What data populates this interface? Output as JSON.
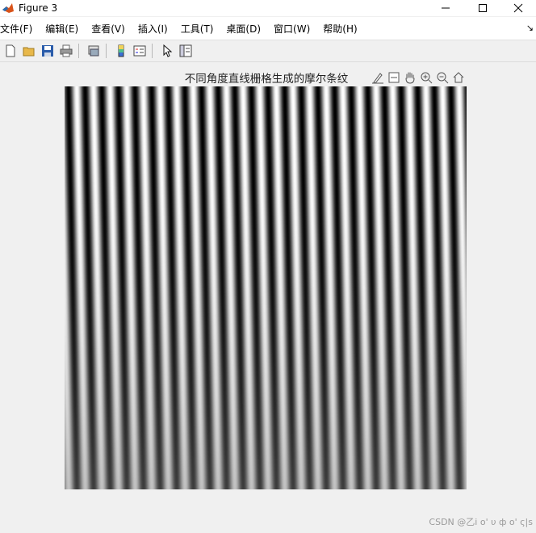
{
  "window": {
    "title": "Figure 3",
    "controls": [
      "minimize",
      "maximize",
      "close"
    ]
  },
  "menubar": {
    "items": [
      {
        "label": "文件(F)"
      },
      {
        "label": "编辑(E)"
      },
      {
        "label": "查看(V)"
      },
      {
        "label": "插入(I)"
      },
      {
        "label": "工具(T)"
      },
      {
        "label": "桌面(D)"
      },
      {
        "label": "窗口(W)"
      },
      {
        "label": "帮助(H)"
      }
    ],
    "overflow_icon": "chevron-icon"
  },
  "toolbar": {
    "buttons": [
      "new-figure-icon",
      "open-file-icon",
      "save-icon",
      "print-icon",
      "link-plot-icon",
      "insert-colorbar-icon",
      "insert-legend-icon",
      "edit-pointer-icon",
      "property-inspector-icon"
    ]
  },
  "axes": {
    "title": "不同角度直线栅格生成的摩尔条纹",
    "toolbar": [
      "brush-icon",
      "data-tips-icon",
      "pan-icon",
      "zoom-in-icon",
      "zoom-out-icon",
      "home-icon"
    ]
  },
  "image": {
    "pattern": "moire",
    "colormap": "gray"
  },
  "watermark": {
    "text": "CSDN @乙i o' υ ф o' ς|s"
  }
}
